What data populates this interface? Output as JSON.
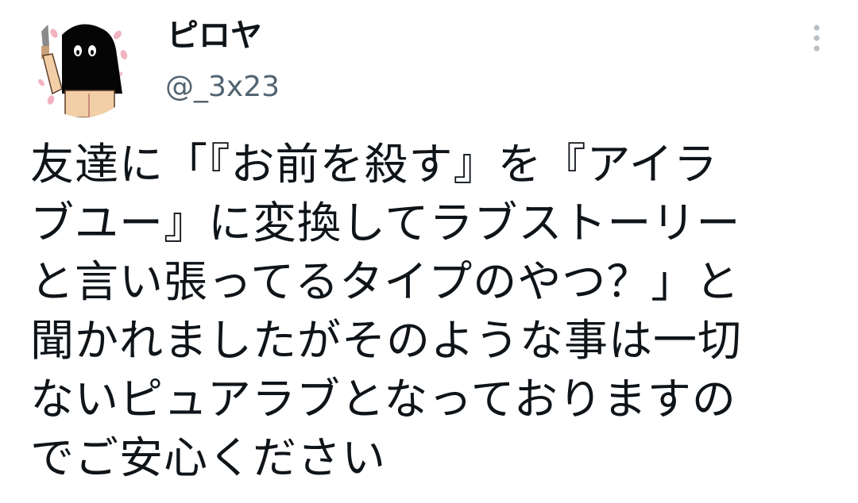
{
  "user": {
    "display_name": "ピロヤ",
    "handle": "@_3x23",
    "avatar_icon": "hooded-figure-avatar"
  },
  "menu": {
    "icon": "more-vertical-icon"
  },
  "tweet": {
    "lines": [
      "友達に「『お前を殺す』を『アイラ",
      "ブユー』に変換してラブストーリー",
      "と言い張ってるタイプのやつ？」と",
      "聞かれましたがそのような事は一切",
      "ないピュアラブとなっておりますの",
      "でご安心ください"
    ]
  },
  "colors": {
    "text": "#0f1419",
    "secondary_text": "#536471",
    "menu_dots": "#b8c0c7",
    "background": "#ffffff"
  }
}
